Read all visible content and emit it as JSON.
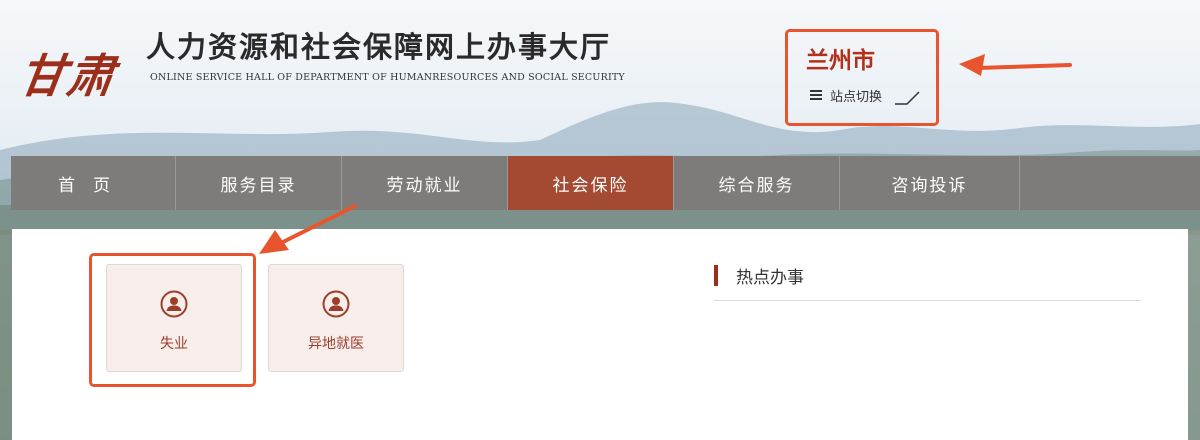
{
  "header": {
    "logo_text": "甘肃",
    "title": "人力资源和社会保障网上办事大厅",
    "subtitle": "ONLINE SERVICE HALL OF DEPARTMENT OF HUMANRESOURCES AND SOCIAL SECURITY",
    "city": "兰州市",
    "switch_label": "站点切换"
  },
  "nav": {
    "items": [
      {
        "label": "首页",
        "active": false
      },
      {
        "label": "服务目录",
        "active": false
      },
      {
        "label": "劳动就业",
        "active": false
      },
      {
        "label": "社会保险",
        "active": true
      },
      {
        "label": "综合服务",
        "active": false
      },
      {
        "label": "咨询投诉",
        "active": false
      }
    ]
  },
  "services": [
    {
      "label": "失业",
      "icon": "person-circle-icon",
      "highlighted": true
    },
    {
      "label": "异地就医",
      "icon": "person-circle-icon",
      "highlighted": false
    }
  ],
  "hot": {
    "title": "热点办事"
  },
  "colors": {
    "brand_red": "#9c2f1c",
    "active_tab": "#a44a33",
    "nav_bg": "#7d7c7a",
    "annotation_orange": "#e8542d",
    "tile_bg": "#f7eeec"
  }
}
